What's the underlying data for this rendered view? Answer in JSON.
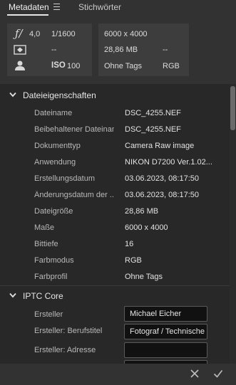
{
  "tabs": [
    {
      "label": "Metadaten",
      "active": true
    },
    {
      "label": "Stichwörter",
      "active": false
    }
  ],
  "summary": {
    "aperture_symbol": "ƒ/",
    "aperture": "4,0",
    "shutter": "1/1600",
    "metering": "--",
    "iso_label": "ISO",
    "iso_value": "100",
    "dimensions": "6000 x 4000",
    "file_size": "28,86 MB",
    "resolution": "--",
    "color_profile": "Ohne Tags",
    "color_mode": "RGB"
  },
  "file_props": {
    "title": "Dateieigenschaften",
    "rows": [
      {
        "label": "Dateiname",
        "value": "DSC_4255.NEF"
      },
      {
        "label": "Beibehaltener Dateiname",
        "value": "DSC_4255.NEF"
      },
      {
        "label": "Dokumenttyp",
        "value": "Camera Raw image"
      },
      {
        "label": "Anwendung",
        "value": "NIKON D7200 Ver.1.02..."
      },
      {
        "label": "Erstellungsdatum",
        "value": "03.06.2023, 08:17:50"
      },
      {
        "label": "Änderungsdatum der ...",
        "value": "03.06.2023, 08:17:50"
      },
      {
        "label": "Dateigröße",
        "value": "28,86 MB"
      },
      {
        "label": "Maße",
        "value": "6000 x 4000"
      },
      {
        "label": "Bittiefe",
        "value": "16"
      },
      {
        "label": "Farbmodus",
        "value": "RGB"
      },
      {
        "label": "Farbprofil",
        "value": "Ohne Tags"
      }
    ]
  },
  "iptc": {
    "title": "IPTC Core",
    "rows": [
      {
        "label": "Ersteller",
        "value": "Michael Eicher"
      },
      {
        "label": "Ersteller: Berufstitel",
        "value": "Fotograf / Technische"
      },
      {
        "label": "Ersteller: Adresse",
        "value": ""
      },
      {
        "label": "",
        "value": ""
      }
    ]
  },
  "footer": {
    "cancel_icon": "close-icon",
    "confirm_icon": "checkmark-icon"
  }
}
